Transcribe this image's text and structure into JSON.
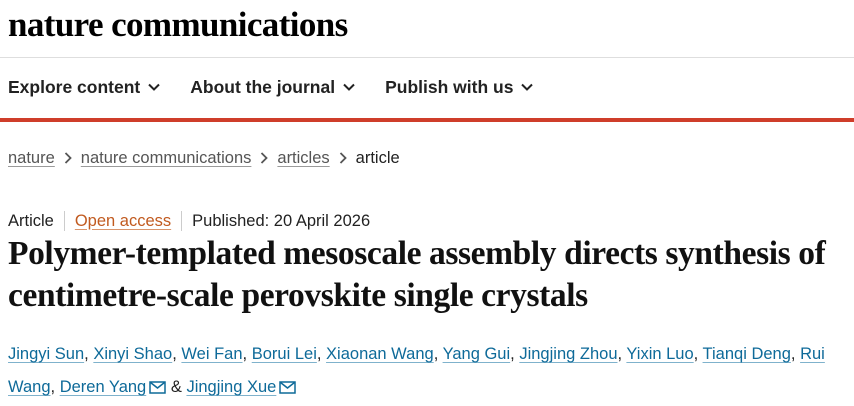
{
  "site": {
    "logo": "nature communications"
  },
  "nav": {
    "items": [
      {
        "label": "Explore content",
        "icon": "chevron-down-icon"
      },
      {
        "label": "About the journal",
        "icon": "chevron-down-icon"
      },
      {
        "label": "Publish with us",
        "icon": "chevron-down-icon"
      }
    ]
  },
  "breadcrumb": {
    "items": [
      "nature",
      "nature communications",
      "articles"
    ],
    "current": "article",
    "separator_icon": "chevron-right-icon"
  },
  "article": {
    "type": "Article",
    "access": "Open access",
    "published": "Published: 20 April 2026",
    "title": "Polymer-templated mesoscale assembly directs synthesis of centimetre-scale perovskite single crystals",
    "authors": [
      "Jingyi Sun",
      "Xinyi Shao",
      "Wei Fan",
      "Borui Lei",
      "Xiaonan Wang",
      "Yang Gui",
      "Jingjing Zhou",
      "Yixin Luo",
      "Tianqi Deng",
      "Rui Wang",
      "Deren Yang",
      "Jingjing Xue"
    ],
    "author_separator": ",",
    "author_and": "&",
    "corresponding_icon": "mail-icon"
  },
  "colors": {
    "brand_red": "#cf3d2a",
    "link_blue": "#0e6a99",
    "open_access_orange": "#c15a1f"
  }
}
